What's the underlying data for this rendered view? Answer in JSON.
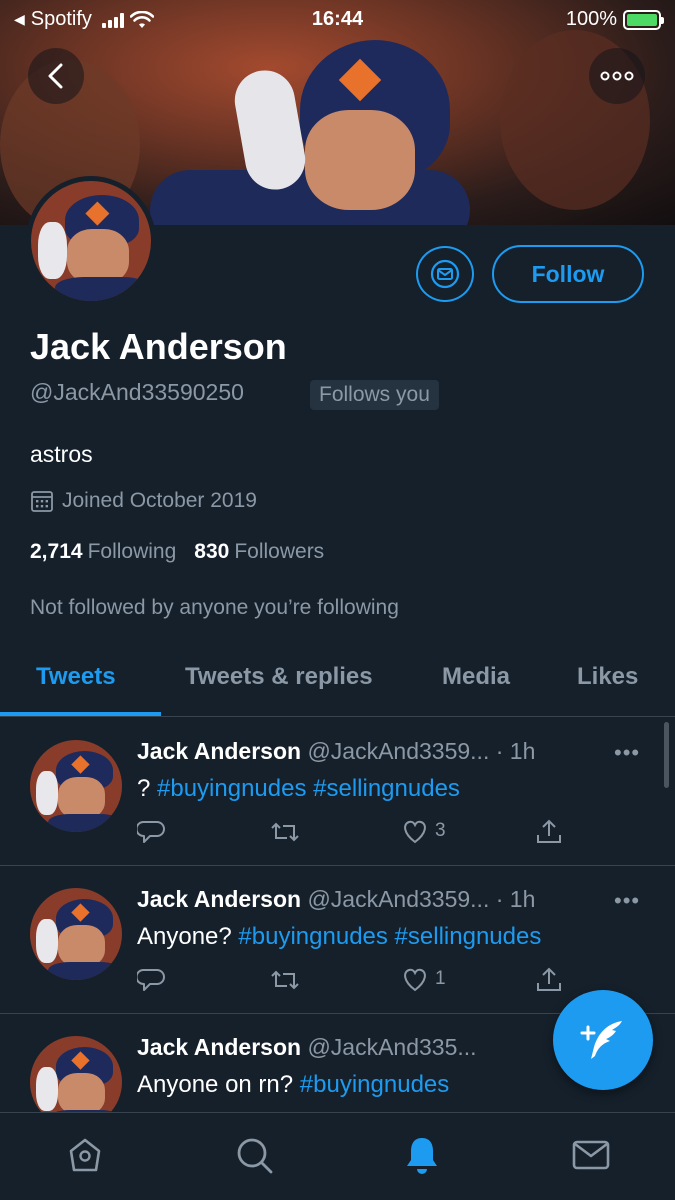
{
  "status_bar": {
    "carrier_app": "Spotify",
    "time": "16:44",
    "battery": "100%"
  },
  "profile": {
    "name": "Jack Anderson",
    "handle": "@JackAnd33590250",
    "follows_you": "Follows you",
    "bio": "astros",
    "joined": "Joined October 2019",
    "following_count": "2,714",
    "following_label": "Following",
    "followers_count": "830",
    "followers_label": "Followers",
    "not_followed": "Not followed by anyone you’re following",
    "follow_label": "Follow"
  },
  "tabs": [
    {
      "label": "Tweets"
    },
    {
      "label": "Tweets & replies"
    },
    {
      "label": "Media"
    },
    {
      "label": "Likes"
    }
  ],
  "tweets": [
    {
      "name": "Jack Anderson",
      "handle": "@JackAnd3359...",
      "time": "· 1h",
      "text_prefix": "? ",
      "tags": "#buyingnudes #sellingnudes",
      "likes": "3"
    },
    {
      "name": "Jack Anderson",
      "handle": "@JackAnd3359...",
      "time": "· 1h",
      "text_prefix": "Anyone? ",
      "tags": "#buyingnudes #sellingnudes",
      "likes": "1"
    },
    {
      "name": "Jack Anderson",
      "handle": "@JackAnd335...",
      "time": "",
      "text_prefix": "Anyone on rn? ",
      "tags": "#buyingnudes",
      "likes": ""
    }
  ],
  "colors": {
    "background": "#15202b",
    "accent": "#1d9bf0",
    "muted": "#8b98a5",
    "divider": "#38444d"
  },
  "icons": {
    "back": "back-arrow-icon",
    "more": "more-icon",
    "message": "envelope-icon",
    "calendar": "calendar-icon",
    "reply": "reply-icon",
    "retweet": "retweet-icon",
    "like": "heart-icon",
    "share": "share-icon",
    "compose": "compose-tweet-icon",
    "home": "home-icon",
    "search": "search-icon",
    "notifications": "bell-icon",
    "messages": "envelope-icon"
  }
}
